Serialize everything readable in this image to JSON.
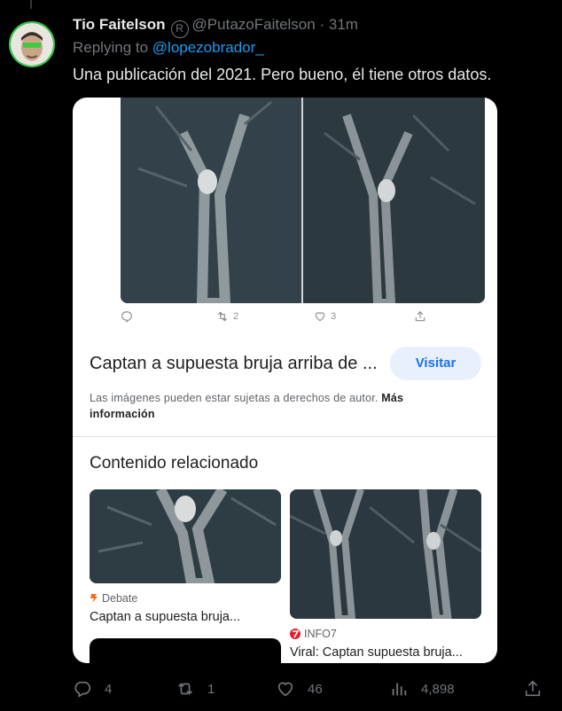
{
  "tweet": {
    "display_name": "Tio Faitelson",
    "handle": "@PutazoFaitelson",
    "separator": "·",
    "time": "31m",
    "replying_prefix": "Replying to ",
    "replying_to": "@lopezobrador_",
    "text": "Una publicación del 2021. Pero bueno, él tiene otros datos."
  },
  "card": {
    "mini_actions": {
      "retweets": "2",
      "likes": "3"
    },
    "title": "Captan a supuesta bruja arriba de ...",
    "visit_label": "Visitar",
    "copyright_text": "Las imágenes pueden estar sujetas a derechos de autor. ",
    "more_info": "Más información",
    "related_heading": "Contenido relacionado",
    "related": [
      {
        "source": "Debate",
        "caption": "Captan a supuesta bruja..."
      },
      {
        "source": "INFO7",
        "caption": "Viral: Captan supuesta bruja..."
      }
    ]
  },
  "actions": {
    "replies": "4",
    "retweets": "1",
    "likes": "46",
    "views": "4,898"
  },
  "colors": {
    "accent": "#1d9bf0",
    "muted": "#71767b",
    "avatar_ring": "#2ecc40",
    "visit_bg": "#e8f0fe",
    "visit_fg": "#1a73e8"
  }
}
